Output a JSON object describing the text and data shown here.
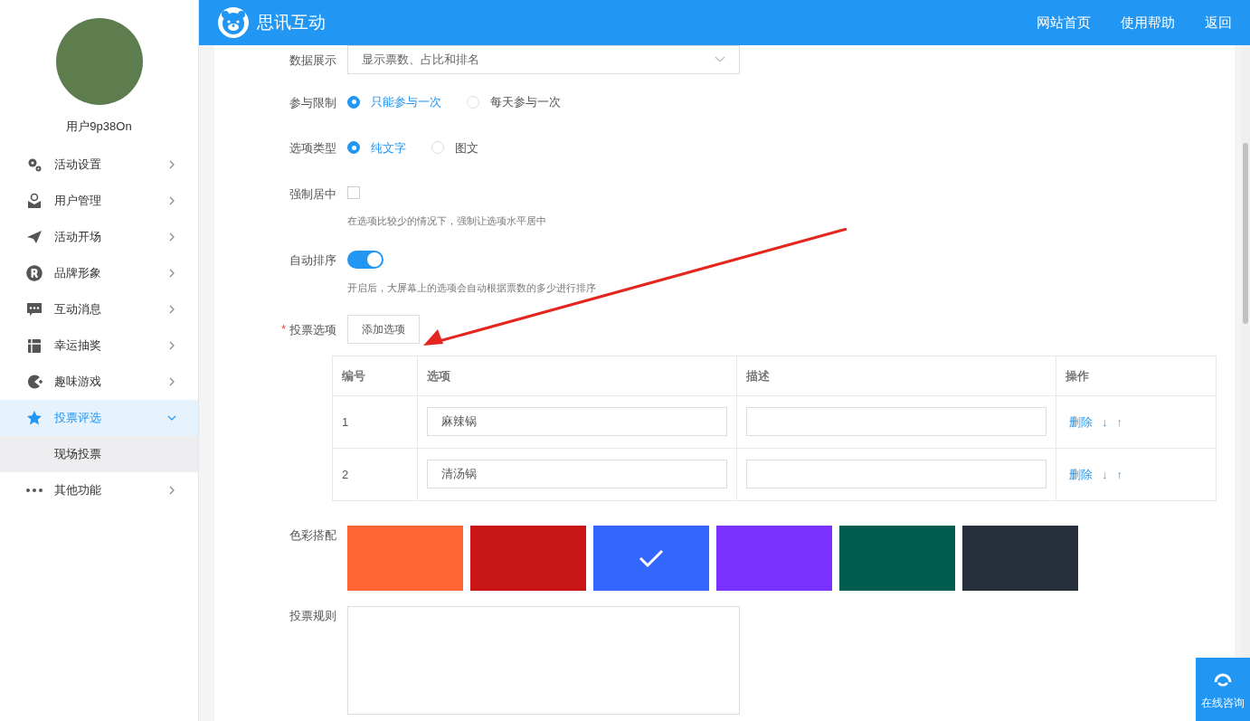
{
  "header": {
    "brand": "思讯互动",
    "links": [
      "网站首页",
      "使用帮助",
      "返回"
    ]
  },
  "sidebar": {
    "username": "用户9p38On",
    "items": [
      {
        "label": "活动设置",
        "expanded": false,
        "selected": false
      },
      {
        "label": "用户管理",
        "expanded": false,
        "selected": false
      },
      {
        "label": "活动开场",
        "expanded": false,
        "selected": false
      },
      {
        "label": "品牌形象",
        "expanded": false,
        "selected": false
      },
      {
        "label": "互动消息",
        "expanded": false,
        "selected": false
      },
      {
        "label": "幸运抽奖",
        "expanded": false,
        "selected": false
      },
      {
        "label": "趣味游戏",
        "expanded": false,
        "selected": false
      },
      {
        "label": "投票评选",
        "expanded": true,
        "selected": true,
        "children": [
          {
            "label": "现场投票",
            "selected": true
          }
        ]
      },
      {
        "label": "其他功能",
        "expanded": false,
        "selected": false
      }
    ]
  },
  "form": {
    "data_display": {
      "label": "数据展示",
      "value": "显示票数、占比和排名"
    },
    "limit": {
      "label": "参与限制",
      "options": [
        {
          "label": "只能参与一次",
          "selected": true
        },
        {
          "label": "每天参与一次",
          "selected": false
        }
      ]
    },
    "option_type": {
      "label": "选项类型",
      "options": [
        {
          "label": "纯文字",
          "selected": true
        },
        {
          "label": "图文",
          "selected": false
        }
      ]
    },
    "force_center": {
      "label": "强制居中",
      "checked": false,
      "hint": "在选项比较少的情况下，强制让选项水平居中"
    },
    "auto_sort": {
      "label": "自动排序",
      "on": true,
      "hint": "开启后，大屏幕上的选项会自动根据票数的多少进行排序"
    },
    "vote_options": {
      "label": "投票选项",
      "required_mark": "*",
      "add_button": "添加选项",
      "columns": [
        "编号",
        "选项",
        "描述",
        "操作"
      ],
      "rows": [
        {
          "number": "1",
          "option": "麻辣锅",
          "delete": "删除",
          "down": "↓",
          "up": "↑",
          "down_enabled": true,
          "up_enabled": false
        },
        {
          "number": "2",
          "option": "清汤锅",
          "delete": "删除",
          "down": "↓",
          "up": "↑",
          "down_enabled": false,
          "up_enabled": true
        }
      ]
    },
    "colors": {
      "label": "色彩搭配",
      "swatches": [
        {
          "color": "#ff6633",
          "selected": false
        },
        {
          "color": "#c81616",
          "selected": false
        },
        {
          "color": "#3366ff",
          "selected": true
        },
        {
          "color": "#7a33ff",
          "selected": false
        },
        {
          "color": "#005c50",
          "selected": false
        },
        {
          "color": "#27303a",
          "selected": false
        }
      ]
    },
    "rules": {
      "label": "投票规则"
    }
  },
  "consult": {
    "label": "在线咨询"
  }
}
